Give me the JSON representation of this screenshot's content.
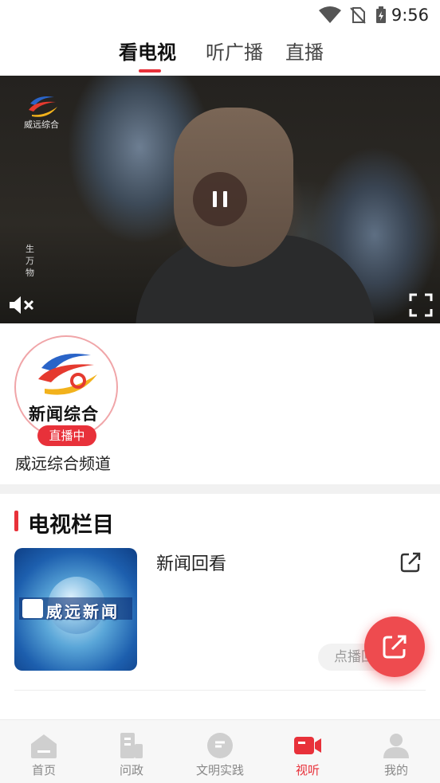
{
  "status_bar": {
    "time": "9:56",
    "icons": [
      "wifi-icon",
      "no-sim-icon",
      "battery-charging-icon"
    ]
  },
  "top_tabs": [
    {
      "label": "看电视",
      "active": true
    },
    {
      "label": "听广播",
      "active": false
    },
    {
      "label": "直播",
      "active": false
    }
  ],
  "player": {
    "channel_bug_text": "威远综合",
    "watermark_text": "生万物",
    "state": "playing",
    "controls": [
      "pause-icon",
      "mute-icon",
      "fullscreen-icon"
    ]
  },
  "channel": {
    "logo_text": "新闻综合",
    "live_badge": "直播中",
    "name": "威远综合频道"
  },
  "section": {
    "title": "电视栏目"
  },
  "programs": [
    {
      "title": "新闻回看",
      "thumb_text": "威远新闻",
      "vod_button": "点播回"
    }
  ],
  "bottom_nav": [
    {
      "label": "首页",
      "icon": "home-icon",
      "active": false
    },
    {
      "label": "问政",
      "icon": "building-icon",
      "active": false
    },
    {
      "label": "文明实践",
      "icon": "chat-bubble-icon",
      "active": false
    },
    {
      "label": "视听",
      "icon": "video-camera-icon",
      "active": true
    },
    {
      "label": "我的",
      "icon": "person-icon",
      "active": false
    }
  ],
  "colors": {
    "accent": "#e8313a",
    "nav_inactive": "#888888",
    "background": "#ffffff"
  }
}
